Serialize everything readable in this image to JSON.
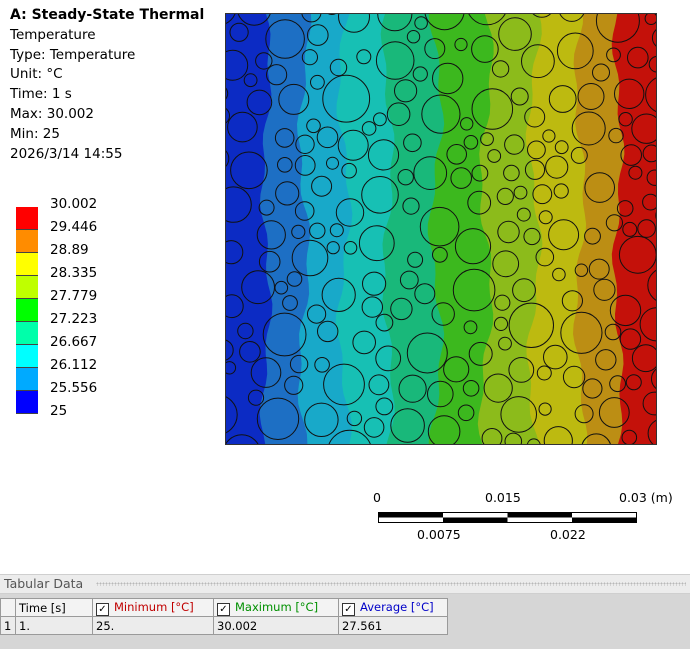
{
  "result": {
    "title": "A: Steady-State Thermal",
    "name": "Temperature",
    "type": "Type: Temperature",
    "unit": "Unit: °C",
    "time": "Time: 1 s",
    "max": "Max: 30.002",
    "min": "Min: 25",
    "date": "2026/3/14 14:55"
  },
  "legend": {
    "labels": [
      "30.002",
      "29.446",
      "28.89",
      "28.335",
      "27.779",
      "27.223",
      "26.667",
      "26.112",
      "25.556",
      "25"
    ],
    "colors": [
      "#ff0000",
      "#ff8c00",
      "#ffff00",
      "#bfff00",
      "#00ff00",
      "#00ffaa",
      "#00ffff",
      "#00aaff",
      "#0000ff"
    ]
  },
  "contour": {
    "band_colors": [
      "#0c2bc4",
      "#1d6fc4",
      "#18a9c9",
      "#17c0b4",
      "#19b87a",
      "#3cb81e",
      "#8cbb1b",
      "#bdba10",
      "#bc8e14",
      "#c4110a"
    ]
  },
  "scale_bar": {
    "top_labels": [
      "0",
      "0.015",
      "0.03 (m)"
    ],
    "bottom_labels": [
      "0.0075",
      "0.022"
    ]
  },
  "tabular": {
    "title": "Tabular Data",
    "headers": [
      "Time [s]",
      "Minimum [°C]",
      "Maximum [°C]",
      "Average [°C]"
    ],
    "header_colors": [
      "#000000",
      "#c00000",
      "#009000",
      "#0000c8"
    ],
    "row_index": "1",
    "row": [
      "1.",
      "25.",
      "30.002",
      "27.561"
    ]
  }
}
